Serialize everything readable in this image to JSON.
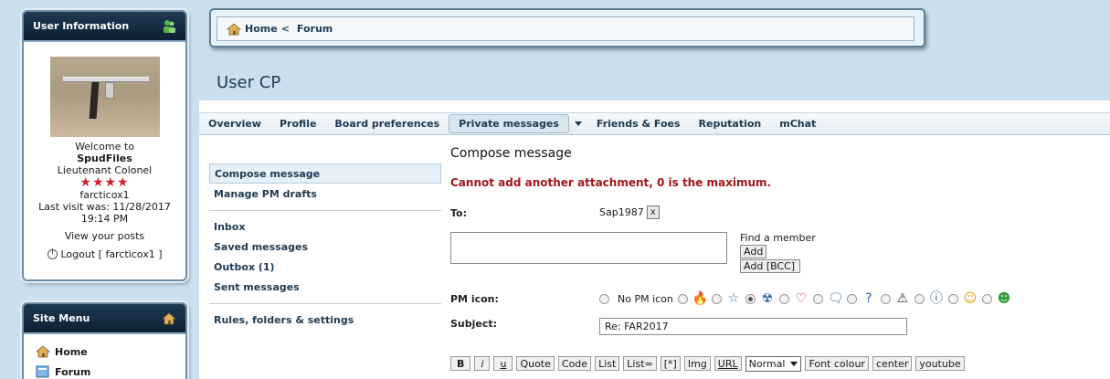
{
  "user_panel": {
    "title": "User Information",
    "welcome": "Welcome to",
    "site_name": "SpudFiles",
    "rank": "Lieutenant Colonel",
    "stars": "★★★★",
    "username": "farcticox1",
    "last_visit": "Last visit was: 11/28/2017",
    "last_visit_time": "19:14 PM",
    "view_posts": "View your posts",
    "logout": "Logout [ farcticox1 ]"
  },
  "site_menu": {
    "title": "Site Menu",
    "items": [
      {
        "label": "Home",
        "icon": "home-icon"
      },
      {
        "label": "Forum",
        "icon": "forum-icon"
      }
    ]
  },
  "breadcrumb": {
    "home": "Home",
    "separator": "<",
    "forum": "Forum"
  },
  "page_title": "User CP",
  "tabs": [
    {
      "label": "Overview"
    },
    {
      "label": "Profile"
    },
    {
      "label": "Board preferences"
    },
    {
      "label": "Private messages",
      "active": true
    },
    {
      "label": "Friends & Foes"
    },
    {
      "label": "Reputation"
    },
    {
      "label": "mChat"
    }
  ],
  "sidenav": {
    "compose": "Compose message",
    "drafts": "Manage PM drafts",
    "inbox": "Inbox",
    "saved": "Saved messages",
    "outbox": "Outbox (1)",
    "sent": "Sent messages",
    "rules": "Rules, folders & settings"
  },
  "compose": {
    "heading": "Compose message",
    "error": "Cannot add another attachment, 0 is the maximum.",
    "to_label": "To:",
    "recipient": "Sap1987",
    "remove_label": "x",
    "find_member": "Find a member",
    "add_label": "Add",
    "add_bcc_label": "Add [BCC]",
    "pm_icon_label": "PM icon:",
    "no_pm_icon": "No PM icon",
    "subject_label": "Subject:",
    "subject_value": "Re: FAR2017"
  },
  "pm_icons": [
    "fire-icon",
    "star-icon",
    "radioactive-icon",
    "heart-icon",
    "speech-bubble-icon",
    "question-icon",
    "warning-icon",
    "info-icon",
    "smiley-icon",
    "grin-icon"
  ],
  "toolbar": {
    "bold": "B",
    "italic": "i",
    "underline": "u",
    "quote": "Quote",
    "code": "Code",
    "list": "List",
    "list_eq": "List=",
    "list_item": "[*]",
    "img": "Img",
    "url": "URL",
    "font_size": "Normal",
    "font_colour": "Font colour",
    "center": "center",
    "youtube": "youtube"
  }
}
